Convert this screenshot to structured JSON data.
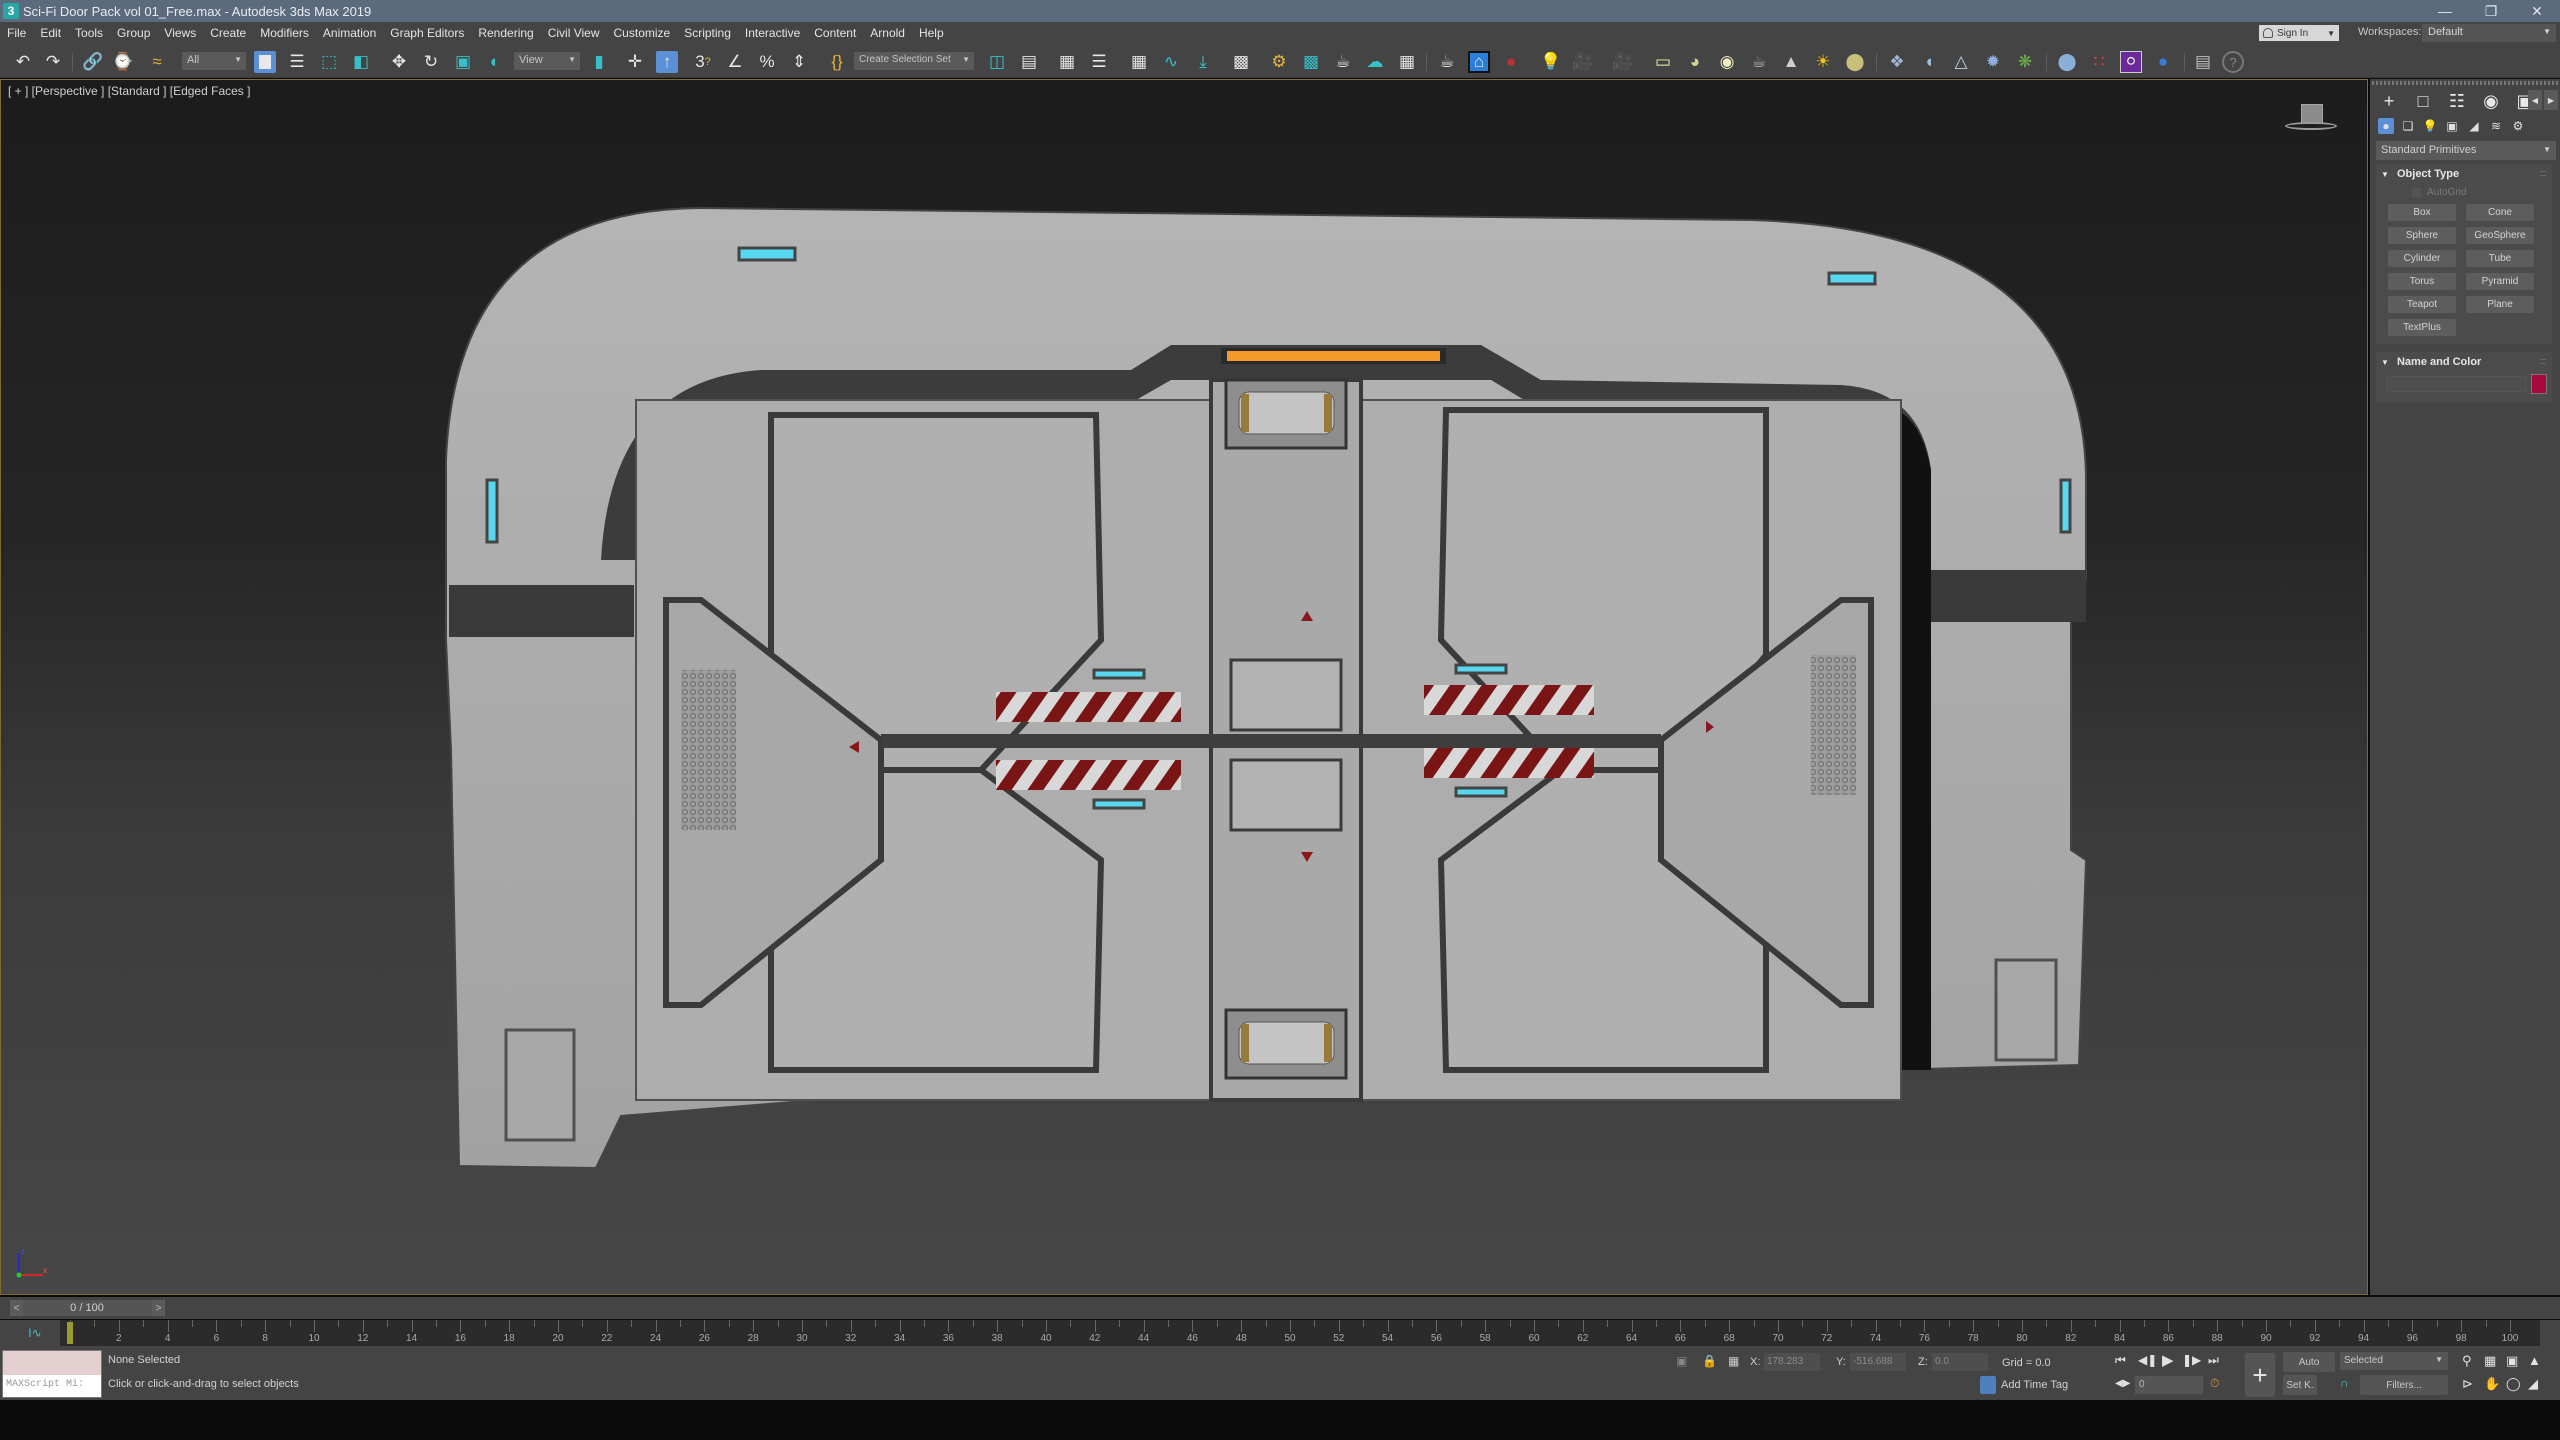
{
  "window": {
    "title": "Sci-Fi Door Pack vol 01_Free.max - Autodesk 3ds Max 2019",
    "logo": "3",
    "controls": [
      "minimize",
      "restore",
      "close"
    ]
  },
  "menu": {
    "items": [
      "File",
      "Edit",
      "Tools",
      "Group",
      "Views",
      "Create",
      "Modifiers",
      "Animation",
      "Graph Editors",
      "Rendering",
      "Civil View",
      "Customize",
      "Scripting",
      "Interactive",
      "Content",
      "Arnold",
      "Help"
    ],
    "sign_in": "Sign In",
    "workspaces_label": "Workspaces:",
    "workspace_value": "Default"
  },
  "toolbar": {
    "selection_filter": "All",
    "reference_coord": "View",
    "named_selection_placeholder": "Create Selection Set",
    "icons": [
      "undo-icon",
      "redo-icon",
      "link-icon",
      "unlink-icon",
      "bind-space-warp-icon",
      "select-object-icon",
      "select-by-name-icon",
      "rect-selection-region-icon",
      "window-crossing-icon",
      "select-move-icon",
      "select-rotate-icon",
      "select-scale-icon",
      "select-place-icon",
      "use-pivot-center-icon",
      "select-manipulate-icon",
      "keyboard-shortcut-override-icon",
      "snaps-toggle-icon",
      "angle-snap-icon",
      "percent-snap-icon",
      "spinner-snap-icon",
      "edit-named-selection-icon",
      "mirror-icon",
      "align-icon",
      "toggle-scene-explorer-icon",
      "toggle-layer-explorer-icon",
      "toggle-ribbon-icon",
      "curve-editor-icon",
      "schematic-view-icon",
      "material-editor-icon",
      "render-setup-icon",
      "rendered-frame-window-icon",
      "render-production-icon",
      "render-iterative-icon",
      "render-in-cloud-icon",
      "render-shortcuts-icon",
      "arnold-render-icon",
      "activeshade-icon",
      "render-frame-icon",
      "light-lister-icon",
      "camera-icon",
      "physical-camera-icon",
      "light-icon",
      "plane-light-icon",
      "sphere-icon",
      "sphere-light-icon",
      "teapot-icon",
      "cone-icon",
      "sun-icon",
      "dome-icon",
      "scatter-icon",
      "peel-icon",
      "tower-icon",
      "geosphere-icon",
      "grass-icon",
      "blue-sphere-icon",
      "colors-icon",
      "paint-icon",
      "scene-converter-icon",
      "export-icon",
      "help-icon"
    ]
  },
  "viewport": {
    "label": "[ + ] [Perspective ] [Standard ] [Edged Faces ]",
    "axis": {
      "x": "x",
      "y": "y",
      "z": "z"
    },
    "colors": {
      "panel": "#a9a9a9",
      "trim": "#3a3a3a",
      "light_cyan": "#57d8f0",
      "light_orange": "#f39a2a",
      "hazard_red": "#7a1515"
    }
  },
  "command_panel": {
    "tabs": [
      "create-tab",
      "modify-tab",
      "hierarchy-tab",
      "motion-tab",
      "display-tab"
    ],
    "subtabs": [
      "geometry",
      "shapes",
      "lights",
      "cameras",
      "helpers",
      "space-warps",
      "systems"
    ],
    "category": "Standard Primitives",
    "object_type": {
      "title": "Object Type",
      "autogrid": "AutoGrid",
      "buttons": [
        "Box",
        "Cone",
        "Sphere",
        "GeoSphere",
        "Cylinder",
        "Tube",
        "Torus",
        "Pyramid",
        "Teapot",
        "Plane",
        "TextPlus"
      ]
    },
    "name_and_color": {
      "title": "Name and Color",
      "name_value": "",
      "color": "#a5093b"
    }
  },
  "time_slider": {
    "frame_display": "0 / 100",
    "prev": "<",
    "next": ">"
  },
  "track_bar": {
    "start": 0,
    "end": 100,
    "labels_step": 2,
    "current_frame": 0
  },
  "status": {
    "maxscript_placeholder": "MAXScript Mi:",
    "selection": "None Selected",
    "prompt": "Click or click-and-drag to select objects",
    "x_label": "X:",
    "x_value": "178.283",
    "y_label": "Y:",
    "y_value": "-516.688",
    "z_label": "Z:",
    "z_value": "0.0",
    "grid": "Grid = 0.0",
    "add_time_tag": "Add Time Tag",
    "frame_value": "0",
    "auto_key": "Auto",
    "set_key": "Set K.",
    "key_filter": "Selected",
    "filters": "Filters..."
  }
}
